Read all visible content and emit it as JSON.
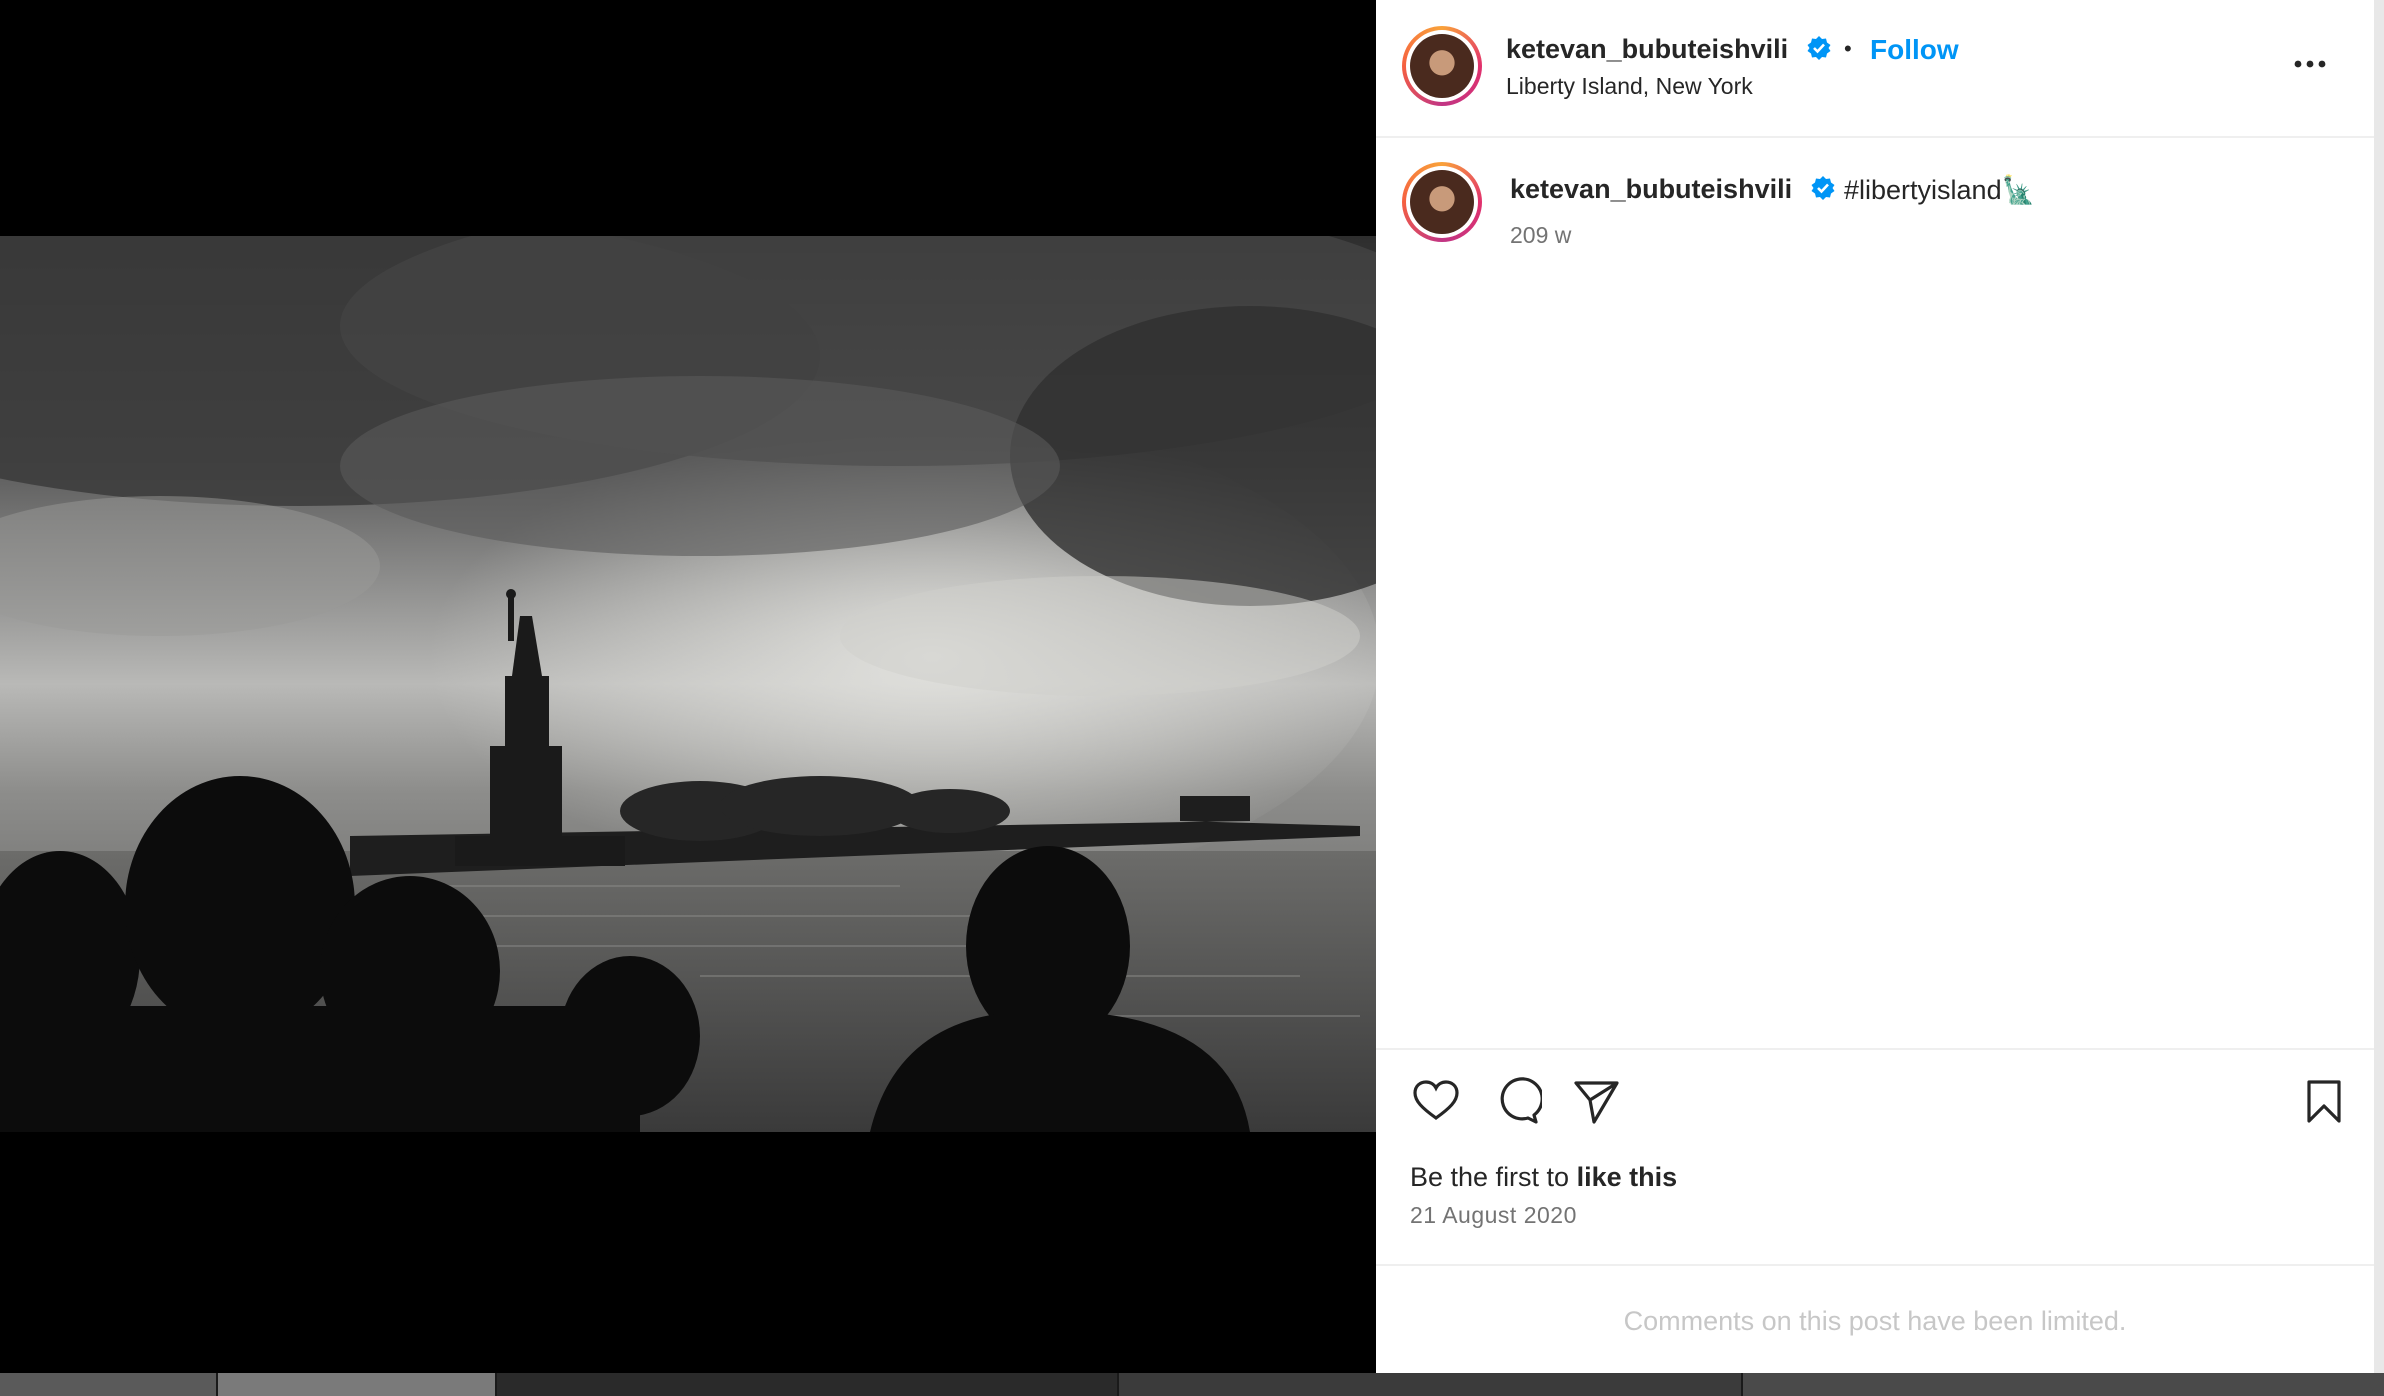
{
  "header": {
    "username": "ketevan_bubuteishvili",
    "dot": "•",
    "follow_label": "Follow",
    "location": "Liberty Island, New York",
    "more_icon": "more-horizontal-icon"
  },
  "caption": {
    "username": "ketevan_bubuteishvili",
    "text": "#libertyisland🗽",
    "age": "209 w"
  },
  "actions": {
    "like_icon": "heart-icon",
    "comment_icon": "comment-icon",
    "share_icon": "send-icon",
    "save_icon": "bookmark-icon"
  },
  "likes": {
    "prefix": "Be the first to ",
    "emphasis": "like this"
  },
  "date": "21 August 2020",
  "comments_notice": "Comments on this post have been limited.",
  "colors": {
    "accent": "#0095f6",
    "verified": "#0095f6",
    "text": "#262626",
    "muted": "#8e8e8e",
    "notice": "#c7c7c7"
  }
}
